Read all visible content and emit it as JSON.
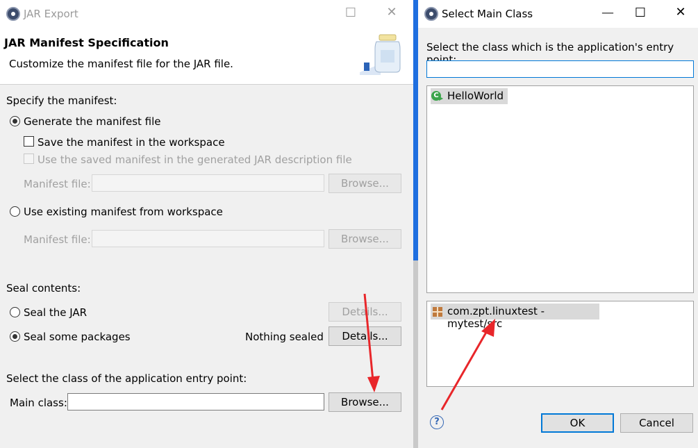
{
  "jar_export": {
    "window_title": "JAR Export",
    "banner": {
      "title": "JAR Manifest Specification",
      "subtitle": "Customize the manifest file for the JAR file."
    },
    "specify_manifest_label": "Specify the manifest:",
    "generate_manifest": "Generate the manifest file",
    "save_manifest": "Save the manifest in the workspace",
    "use_saved_manifest": "Use the saved manifest in the generated JAR description file",
    "manifest_file_label": "Manifest file:",
    "browse_label": "Browse...",
    "use_existing_manifest": "Use existing manifest from workspace",
    "seal_contents_label": "Seal contents:",
    "seal_jar": "Seal the JAR",
    "seal_some_packages": "Seal some packages",
    "nothing_sealed": "Nothing sealed",
    "details_label": "Details...",
    "entry_point_label": "Select the class of the application entry point:",
    "main_class_label": "Main class:",
    "main_class_value": ""
  },
  "select_main_class": {
    "window_title": "Select Main Class",
    "prompt": "Select the class which is the application's entry point:",
    "filter_value": "",
    "classes": [
      "HelloWorld"
    ],
    "packages": [
      "com.zpt.linuxtest - mytest/src"
    ],
    "ok_label": "OK",
    "cancel_label": "Cancel",
    "help_symbol": "?"
  },
  "annotation_color": "#e8262a"
}
